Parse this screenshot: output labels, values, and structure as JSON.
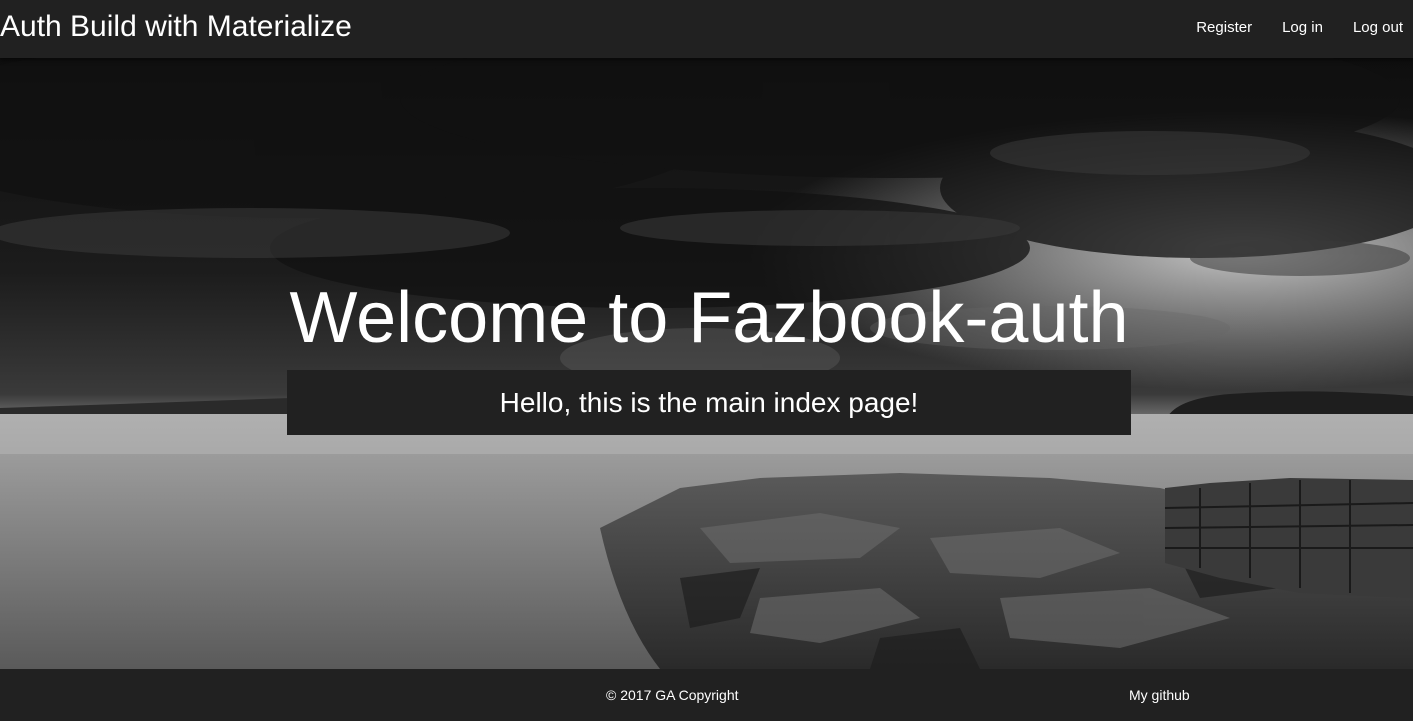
{
  "nav": {
    "brand": "Auth Build with Materialize",
    "links": [
      {
        "label": "Register"
      },
      {
        "label": "Log in"
      },
      {
        "label": "Log out"
      }
    ]
  },
  "hero": {
    "title": "Welcome to Fazbook-auth",
    "subtitle": "Hello, this is the main index page!"
  },
  "footer": {
    "copyright": "© 2017 GA Copyright",
    "github_link": "My github"
  },
  "colors": {
    "navbar": "#212121",
    "footer": "#212121",
    "subtitle_box": "#212121",
    "text": "#ffffff"
  }
}
